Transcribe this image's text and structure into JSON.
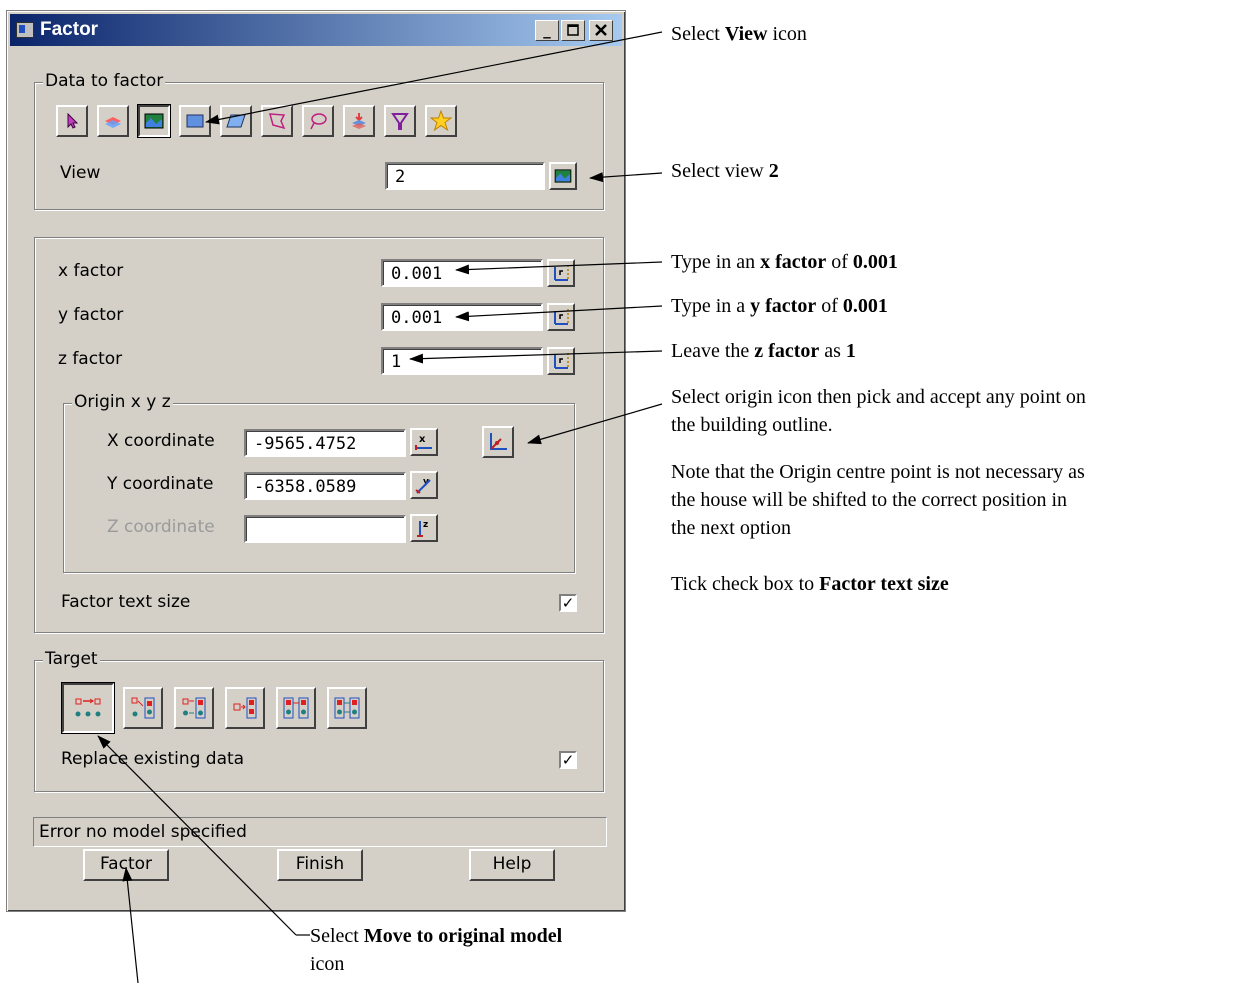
{
  "window": {
    "title": "Factor",
    "minimize": "_",
    "maximize": "□",
    "close": "✕"
  },
  "data_to_factor": {
    "legend": "Data to factor",
    "tools": [
      "select-icon",
      "layers-icon",
      "view-icon",
      "rectangle-icon",
      "polygon-icon",
      "lasso-icon",
      "string-icon",
      "filter-layers-icon",
      "funnel-icon",
      "star-icon"
    ],
    "view_label": "View",
    "view_value": "2"
  },
  "factors": {
    "x_label": "x factor",
    "x_value": "0.001",
    "y_label": "y factor",
    "y_value": "0.001",
    "z_label": "z factor",
    "z_value": "1",
    "origin": {
      "legend": "Origin x y z",
      "x_label": "X coordinate",
      "x_value": "-9565.4752",
      "y_label": "Y coordinate",
      "y_value": "-6358.0589",
      "z_label": "Z coordinate",
      "z_value": ""
    },
    "factor_text_size_label": "Factor text size",
    "factor_text_size_checked": true
  },
  "target": {
    "legend": "Target",
    "replace_label": "Replace existing data",
    "replace_checked": true
  },
  "status_text": "Error no model specified",
  "buttons": {
    "factor": "Factor",
    "finish": "Finish",
    "help": "Help"
  },
  "annotations": {
    "select_view_icon": {
      "pre": "Select ",
      "bold": "View",
      "post": " icon"
    },
    "select_view_2": {
      "pre": "Select view ",
      "bold": "2"
    },
    "x_factor": {
      "pre": "Type in an ",
      "bold": "x factor",
      "mid": " of ",
      "bold2": "0.001"
    },
    "y_factor": {
      "pre": "Type in a ",
      "bold": "y factor",
      "mid": " of ",
      "bold2": "0.001"
    },
    "z_factor": {
      "pre": "Leave the ",
      "bold": "z factor",
      "mid": " as ",
      "bold2": "1"
    },
    "origin_line1": "Select origin icon then pick and accept any point on",
    "origin_line2": "the building outline.",
    "note_line1": "Note that the Origin centre point is not necessary as",
    "note_line2": "the house will be shifted to the correct position in",
    "note_line3": "the next option",
    "tick": {
      "pre": "Tick check box to ",
      "bold": "Factor text size"
    },
    "move_original": {
      "pre": "Select ",
      "bold": "Move to original model"
    },
    "move_original_line2": "icon"
  }
}
